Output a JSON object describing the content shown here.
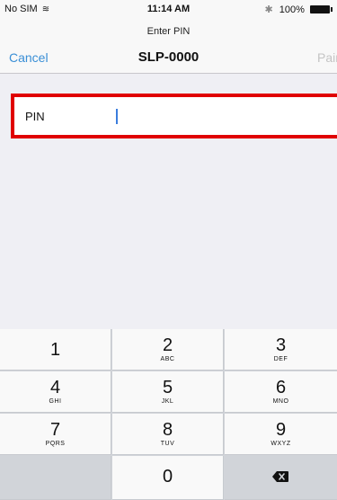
{
  "status_bar": {
    "carrier": "No SIM",
    "time": "11:14 AM",
    "battery": "100%"
  },
  "nav": {
    "prompt": "Enter PIN",
    "cancel": "Cancel",
    "title": "SLP-0000",
    "pair": "Pair"
  },
  "form": {
    "pin_label": "PIN",
    "pin_value": ""
  },
  "keypad": {
    "keys": [
      {
        "digit": "1",
        "letters": ""
      },
      {
        "digit": "2",
        "letters": "ABC"
      },
      {
        "digit": "3",
        "letters": "DEF"
      },
      {
        "digit": "4",
        "letters": "GHI"
      },
      {
        "digit": "5",
        "letters": "JKL"
      },
      {
        "digit": "6",
        "letters": "MNO"
      },
      {
        "digit": "7",
        "letters": "PQRS"
      },
      {
        "digit": "8",
        "letters": "TUV"
      },
      {
        "digit": "9",
        "letters": "WXYZ"
      },
      {
        "digit": "0",
        "letters": ""
      }
    ]
  },
  "icons": {
    "wifi": "wifi-icon",
    "bluetooth": "bluetooth-icon",
    "battery": "battery-icon",
    "backspace": "backspace-icon"
  }
}
